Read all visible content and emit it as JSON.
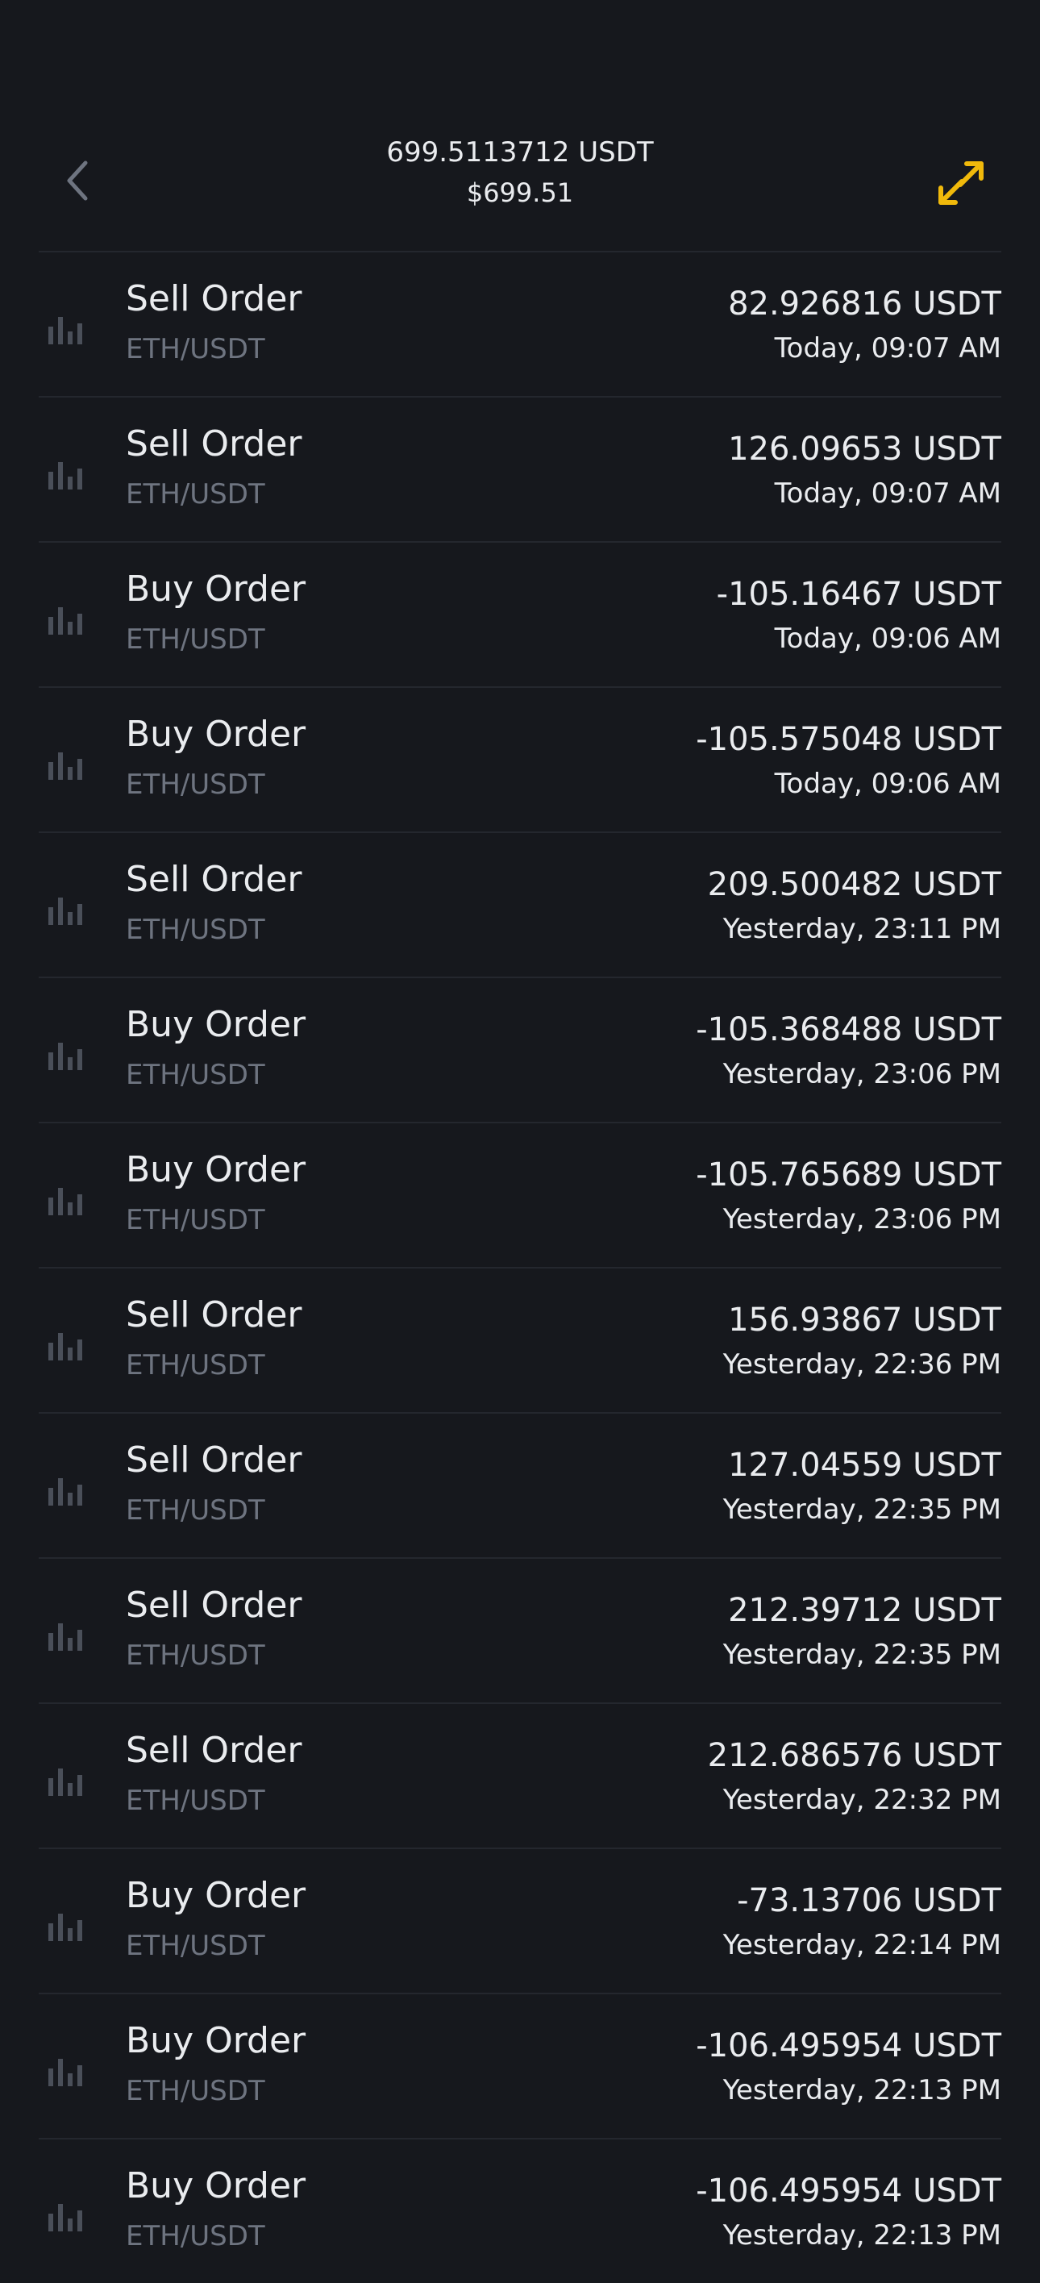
{
  "header": {
    "balance": "699.5113712 USDT",
    "fiat_value": "$699.51",
    "back_icon": "chevron-left-icon",
    "swap_icon": "swap-arrows-icon"
  },
  "colors": {
    "background": "#16181d",
    "accent": "#f0b90b",
    "text_primary": "#eaecef",
    "text_secondary": "#6e7480",
    "divider": "#24272e"
  },
  "orders": [
    {
      "title": "Sell Order",
      "pair": "ETH/USDT",
      "amount": "82.926816 USDT",
      "time": "Today, 09:07 AM"
    },
    {
      "title": "Sell Order",
      "pair": "ETH/USDT",
      "amount": "126.09653 USDT",
      "time": "Today, 09:07 AM"
    },
    {
      "title": "Buy Order",
      "pair": "ETH/USDT",
      "amount": "-105.16467 USDT",
      "time": "Today, 09:06 AM"
    },
    {
      "title": "Buy Order",
      "pair": "ETH/USDT",
      "amount": "-105.575048 USDT",
      "time": "Today, 09:06 AM"
    },
    {
      "title": "Sell Order",
      "pair": "ETH/USDT",
      "amount": "209.500482 USDT",
      "time": "Yesterday, 23:11 PM"
    },
    {
      "title": "Buy Order",
      "pair": "ETH/USDT",
      "amount": "-105.368488 USDT",
      "time": "Yesterday, 23:06 PM"
    },
    {
      "title": "Buy Order",
      "pair": "ETH/USDT",
      "amount": "-105.765689 USDT",
      "time": "Yesterday, 23:06 PM"
    },
    {
      "title": "Sell Order",
      "pair": "ETH/USDT",
      "amount": "156.93867 USDT",
      "time": "Yesterday, 22:36 PM"
    },
    {
      "title": "Sell Order",
      "pair": "ETH/USDT",
      "amount": "127.04559 USDT",
      "time": "Yesterday, 22:35 PM"
    },
    {
      "title": "Sell Order",
      "pair": "ETH/USDT",
      "amount": "212.39712 USDT",
      "time": "Yesterday, 22:35 PM"
    },
    {
      "title": "Sell Order",
      "pair": "ETH/USDT",
      "amount": "212.686576 USDT",
      "time": "Yesterday, 22:32 PM"
    },
    {
      "title": "Buy Order",
      "pair": "ETH/USDT",
      "amount": "-73.13706 USDT",
      "time": "Yesterday, 22:14 PM"
    },
    {
      "title": "Buy Order",
      "pair": "ETH/USDT",
      "amount": "-106.495954 USDT",
      "time": "Yesterday, 22:13 PM"
    },
    {
      "title": "Buy Order",
      "pair": "ETH/USDT",
      "amount": "-106.495954 USDT",
      "time": "Yesterday, 22:13 PM"
    }
  ],
  "order_icon": "bar-chart-icon"
}
